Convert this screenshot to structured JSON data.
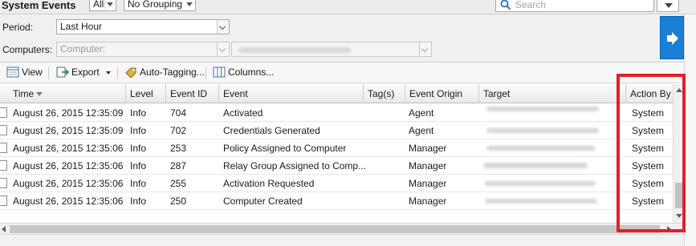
{
  "header": {
    "title": "System Events",
    "filter_value": "All",
    "grouping_value": "No Grouping",
    "search_placeholder": "Search"
  },
  "filters": {
    "period_label": "Period:",
    "period_value": "Last Hour",
    "computers_label": "Computers:",
    "computers_value": "Computer:"
  },
  "toolbar": {
    "view_label": "View",
    "export_label": "Export",
    "autotag_label": "Auto-Tagging...",
    "columns_label": "Columns..."
  },
  "grid": {
    "columns": [
      "Time",
      "Level",
      "Event ID",
      "Event",
      "Tag(s)",
      "Event Origin",
      "Target",
      "Action By"
    ],
    "rows": [
      {
        "time": "August 26, 2015 12:35:09",
        "level": "Info",
        "event_id": "704",
        "event": "Activated",
        "tags": "",
        "origin": "Agent",
        "action_by": "System"
      },
      {
        "time": "August 26, 2015 12:35:09",
        "level": "Info",
        "event_id": "702",
        "event": "Credentials Generated",
        "tags": "",
        "origin": "Agent",
        "action_by": "System"
      },
      {
        "time": "August 26, 2015 12:35:06",
        "level": "Info",
        "event_id": "253",
        "event": "Policy Assigned to Computer",
        "tags": "",
        "origin": "Manager",
        "action_by": "System"
      },
      {
        "time": "August 26, 2015 12:35:06",
        "level": "Info",
        "event_id": "287",
        "event": "Relay Group Assigned to Comp...",
        "tags": "",
        "origin": "Manager",
        "action_by": "System"
      },
      {
        "time": "August 26, 2015 12:35:06",
        "level": "Info",
        "event_id": "255",
        "event": "Activation Requested",
        "tags": "",
        "origin": "Manager",
        "action_by": "System"
      },
      {
        "time": "August 26, 2015 12:35:06",
        "level": "Info",
        "event_id": "250",
        "event": "Computer Created",
        "tags": "",
        "origin": "Manager",
        "action_by": "System"
      }
    ]
  },
  "colors": {
    "accent": "#1a7fd6",
    "annotation": "#e0202a"
  },
  "icons": {
    "search": "search-icon",
    "go": "arrow-right-icon",
    "view": "view-icon",
    "export": "export-icon",
    "autotag": "tag-icon",
    "columns": "columns-icon",
    "row": "document-icon"
  }
}
